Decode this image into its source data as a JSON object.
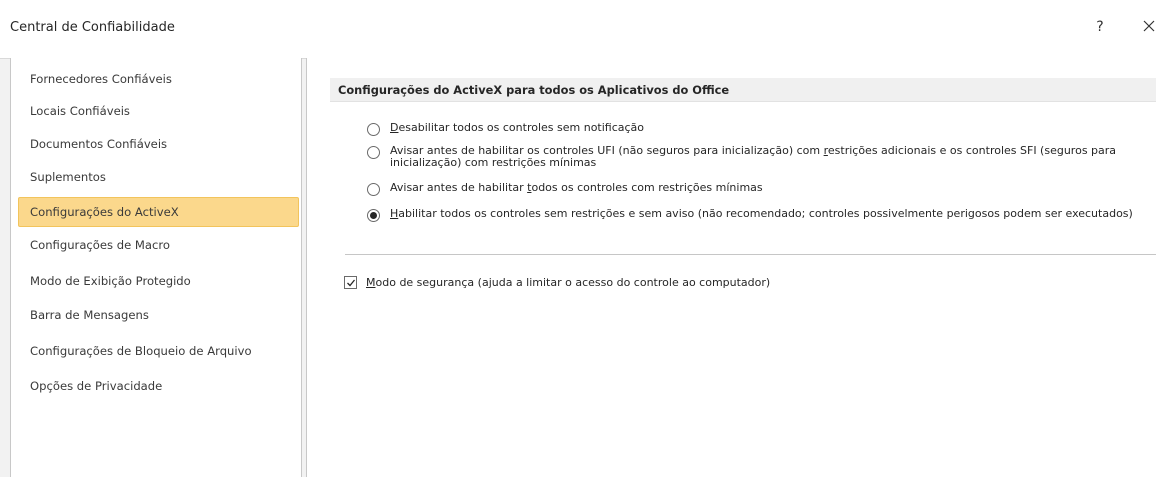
{
  "window": {
    "title": "Central de Confiabilidade",
    "help_label": "?"
  },
  "sidebar": {
    "items": [
      {
        "label": "Fornecedores Confiáveis"
      },
      {
        "label": "Locais Confiáveis"
      },
      {
        "label": "Documentos Confiáveis"
      },
      {
        "label": "Suplementos"
      },
      {
        "label": "Configurações do ActiveX",
        "selected": true
      },
      {
        "label": "Configurações de Macro"
      },
      {
        "label": "Modo de Exibição Protegido"
      },
      {
        "label": "Barra de Mensagens"
      },
      {
        "label": "Configurações de Bloqueio de Arquivo"
      },
      {
        "label": "Opções de Privacidade"
      }
    ]
  },
  "main": {
    "section_title": "Configurações do ActiveX para todos os Aplicativos do Office",
    "options": [
      {
        "accel": "D",
        "rest": "esabilitar todos os controles sem notificação",
        "checked": false
      },
      {
        "pre": "Avisar antes de habilitar os controles UFI (não seguros para inicialização) com ",
        "accel": "r",
        "post": "estrições adicionais e os controles SFI (seguros para inicialização) com restrições mínimas",
        "checked": false
      },
      {
        "pre": "Avisar antes de habilitar ",
        "accel": "t",
        "post": "odos os controles com restrições mínimas",
        "checked": false
      },
      {
        "accel": "H",
        "rest": "abilitar todos os controles sem restrições e sem aviso (não recomendado; controles possivelmente perigosos podem ser executados)",
        "checked": true
      }
    ],
    "safe_mode": {
      "accel": "M",
      "rest": "odo de segurança (ajuda a limitar o acesso do controle ao computador)",
      "checked": true
    }
  },
  "colors": {
    "selected_bg": "#fbd88c",
    "selected_border": "#f2c45c",
    "section_header_bg": "#f0f0f0"
  }
}
